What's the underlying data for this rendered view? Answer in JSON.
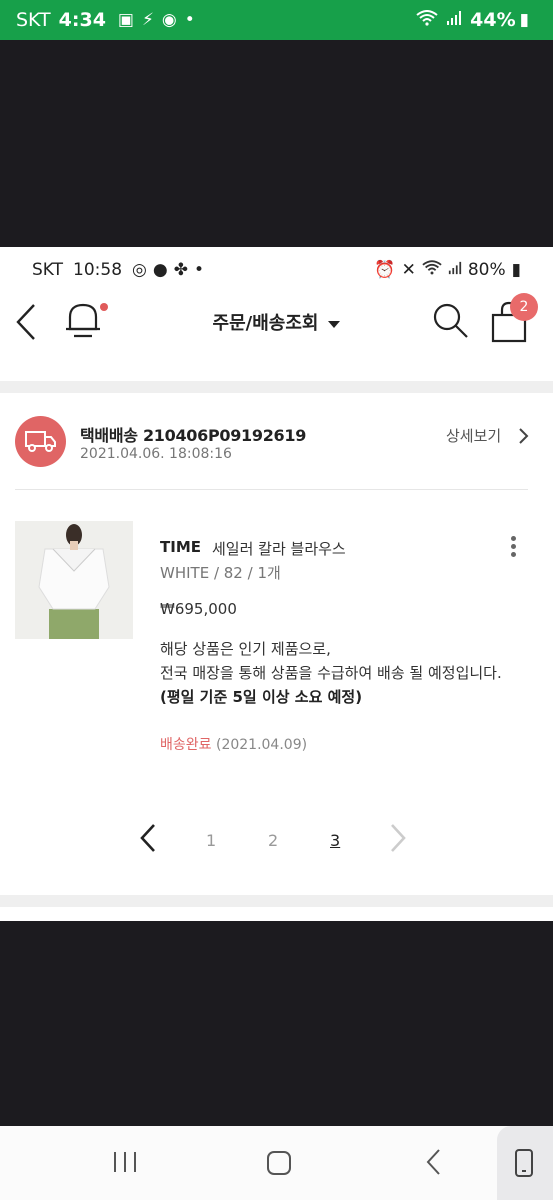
{
  "outer_status": {
    "carrier": "SKT",
    "time": "4:34",
    "battery": "44%"
  },
  "inner_status": {
    "carrier": "SKT",
    "time": "10:58",
    "battery": "80%"
  },
  "header": {
    "title": "주문/배송조회",
    "cart_count": "2"
  },
  "order": {
    "title": "택배배송 210406P09192619",
    "datetime": "2021.04.06. 18:08:16",
    "detail_label": "상세보기"
  },
  "product": {
    "brand": "TIME",
    "name": "세일러 칼라 블라우스",
    "options": "WHITE / 82 / 1개",
    "price": "₩695,000",
    "notice_line1": "해당 상품은 인기 제품으로,",
    "notice_line2": "전국 매장을 통해 상품을 수급하여 배송 될 예정입니다.",
    "notice_line3": "(평일 기준 5일 이상 소요 예정)",
    "status": "배송완료",
    "status_date": "(2021.04.09)"
  },
  "pagination": {
    "pages": [
      "1",
      "2",
      "3"
    ],
    "current": "3"
  },
  "colors": {
    "accent": "#e06565",
    "outer_status_bg": "#17a04a"
  }
}
